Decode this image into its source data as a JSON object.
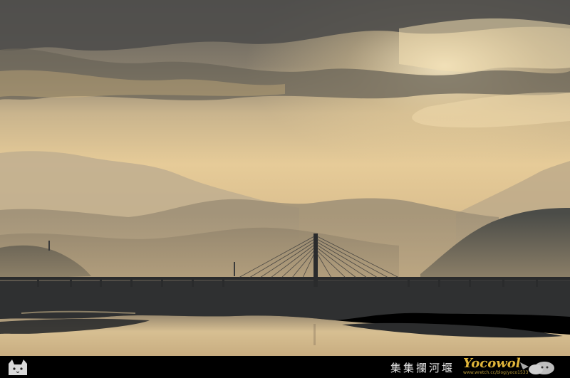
{
  "photo": {
    "subject": "cable-stayed bridge over river at sunset with misty mountains",
    "colors": {
      "sky_top": "#6f6a5f",
      "sky_glow": "#e9c98f",
      "horizon": "#d7b98a",
      "mountain_far": "#b8a78a",
      "mountain_mid": "#8c806d",
      "mountain_near": "#4a4a45",
      "river": "#d8c095",
      "bank": "#2e2f30",
      "bridge": "#2a2b2c"
    }
  },
  "caption": {
    "title": "集集攔河堰",
    "brand": "Yocowol",
    "url": "www.wretch.cc/blog/yoco1533"
  }
}
